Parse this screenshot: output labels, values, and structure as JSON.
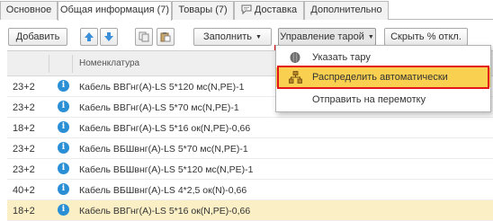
{
  "tabs": [
    {
      "label": "Основное"
    },
    {
      "label": "Общая информация (7)"
    },
    {
      "label": "Товары (7)"
    },
    {
      "label": "Доставка"
    },
    {
      "label": "Дополнительно"
    }
  ],
  "toolbar": {
    "add_label": "Добавить",
    "fill_label": "Заполнить",
    "tare_label": "Управление тарой",
    "hide_label": "Скрыть % откл."
  },
  "grid": {
    "column_name": "Номенклатура",
    "rows": [
      {
        "qty": "23+2",
        "name": "Кабель ВВГнг(А)-LS 5*120 мс(N,PE)-1"
      },
      {
        "qty": "23+2",
        "name": "Кабель ВВГнг(А)-LS 5*70 мс(N,PE)-1"
      },
      {
        "qty": "18+2",
        "name": "Кабель ВВГнг(А)-LS 5*16 ок(N,PE)-0,66"
      },
      {
        "qty": "23+2",
        "name": "Кабель ВБШвнг(А)-LS 5*70 мс(N,PE)-1"
      },
      {
        "qty": "23+2",
        "name": "Кабель ВБШвнг(А)-LS 5*120 мс(N,PE)-1"
      },
      {
        "qty": "40+2",
        "name": "Кабель ВБШвнг(А)-LS 4*2,5 ок(N)-0,66"
      },
      {
        "qty": "18+2",
        "name": "Кабель ВВГнг(А)-LS 5*16 ок(N,PE)-0,66"
      }
    ]
  },
  "menu": {
    "items": [
      {
        "label": "Указать тару",
        "icon": "tare-icon"
      },
      {
        "label": "Распределить автоматически",
        "icon": "distribute-icon"
      },
      {
        "label": "Отправить на перемотку",
        "icon": ""
      }
    ]
  },
  "colors": {
    "highlight": "#f9d04f",
    "selected_row": "#fbefc6",
    "red_frame": "#e3141a",
    "info_icon": "#2b8fd6",
    "arrow_icon": "#3a8fd8"
  }
}
